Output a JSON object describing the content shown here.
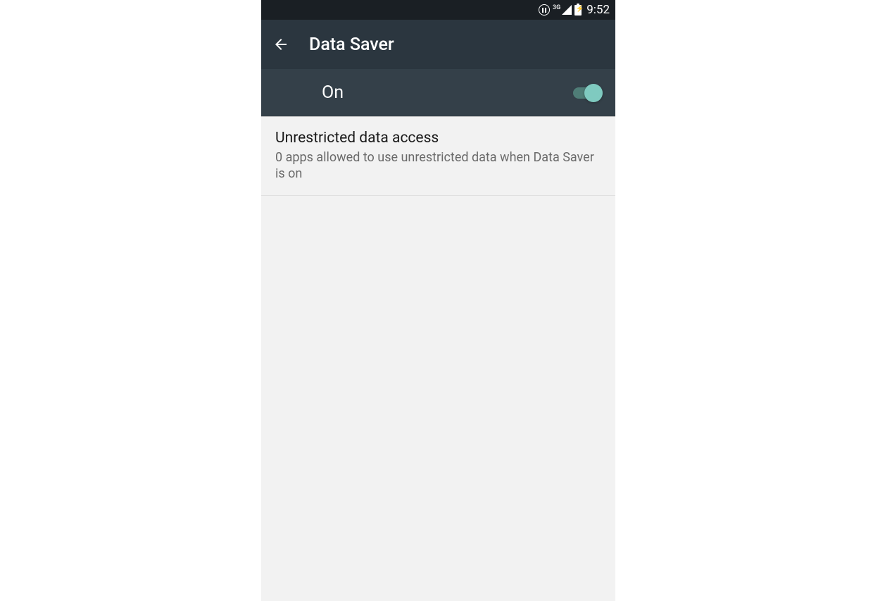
{
  "statusBar": {
    "networkType": "3G",
    "time": "9:52"
  },
  "appBar": {
    "title": "Data Saver"
  },
  "toggle": {
    "stateLabel": "On",
    "enabled": true
  },
  "settings": {
    "unrestricted": {
      "title": "Unrestricted data access",
      "description": "0 apps allowed to use unrestricted data when Data Saver is on"
    }
  }
}
